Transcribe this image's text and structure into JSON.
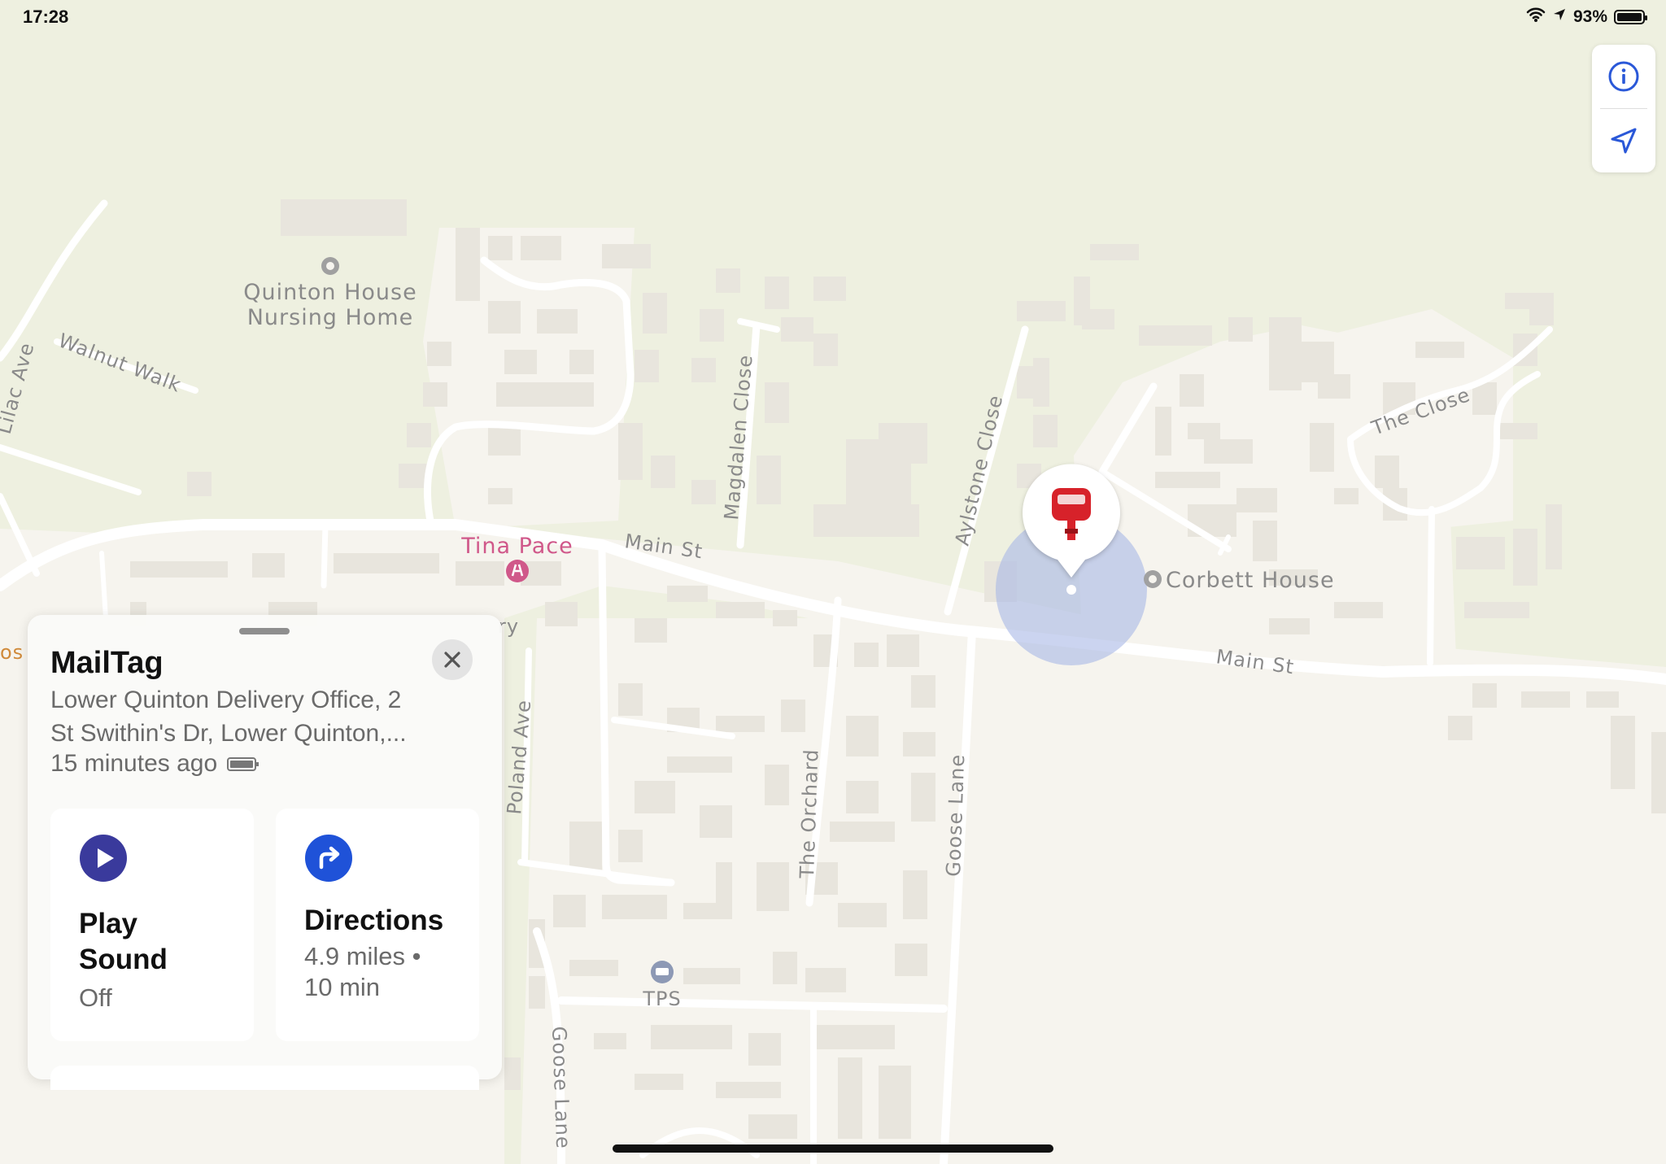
{
  "status_bar": {
    "time": "17:28",
    "battery_percent": "93%",
    "battery_level": 0.93
  },
  "map": {
    "labels": {
      "poi_quinton_house_line1": "Quinton House",
      "poi_quinton_house_line2": "Nursing Home",
      "walnut_walk": "Walnut Walk",
      "lilac_ave": "Lilac Ave",
      "magdalen_close": "Magdalen Close",
      "aylstone_close": "Aylstone Close",
      "the_close": "The Close",
      "main_st_west": "Main St",
      "main_st_east": "Main St",
      "tina_pace": "Tina Pace",
      "corbett_house": "Corbett House",
      "poland_ave": "Poland Ave",
      "the_orchard": "The Orchard",
      "goose_lane_north": "Goose Lane",
      "goose_lane_south": "Goose Lane",
      "tps": "TPS",
      "partial_left": "os",
      "partial_under_card": "ry"
    },
    "colors": {
      "land": "#eef0e0",
      "settlement": "#f6f4ee",
      "road": "#ffffff",
      "building": "#e9e6df",
      "accuracy_circle": "#a9b7e6",
      "pin_red": "#d7222a",
      "poi_pink": "#d0588a"
    }
  },
  "map_controls": {
    "info_icon": "info-icon",
    "location_icon": "location-arrow-icon",
    "accent": "#2a58d8"
  },
  "item_card": {
    "title": "MailTag",
    "address": "Lower Quinton Delivery Office, 2\nSt Swithin's Dr, Lower Quinton,...",
    "updated": "15 minutes ago",
    "play_sound": {
      "label": "Play Sound",
      "status": "Off",
      "icon_color": "#3a3a9c"
    },
    "directions": {
      "label": "Directions",
      "distance": "4.9 miles •",
      "time": "10 min",
      "icon_color": "#1f52d8"
    }
  }
}
